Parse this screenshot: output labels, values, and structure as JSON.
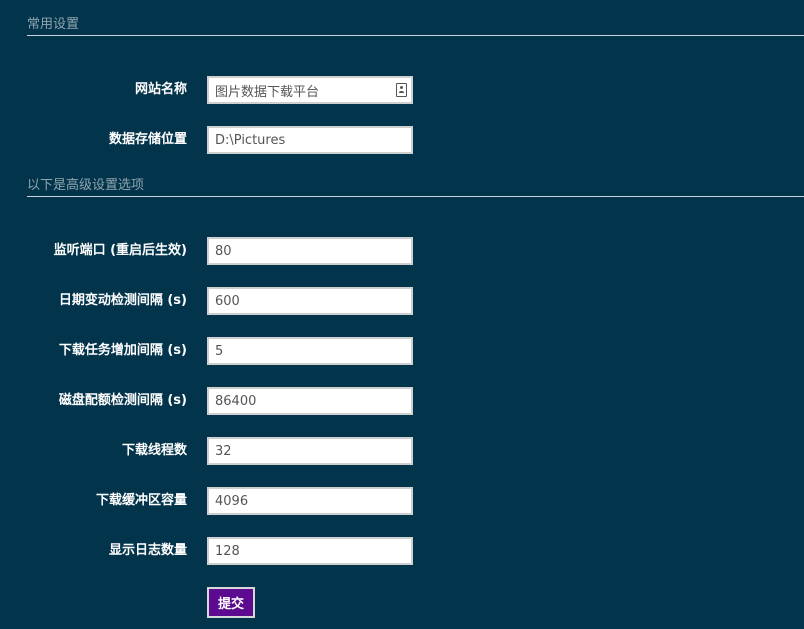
{
  "sections": {
    "common": {
      "title": "常用设置"
    },
    "advanced": {
      "title": "以下是高级设置选项"
    }
  },
  "fields": {
    "site_name": {
      "label": "网站名称",
      "value": "图片数据下载平台"
    },
    "storage_path": {
      "label": "数据存储位置",
      "value": "D:\\Pictures"
    },
    "listen_port": {
      "label": "监听端口 (重启后生效)",
      "value": "80"
    },
    "date_check_interval": {
      "label": "日期变动检测间隔 (s)",
      "value": "600"
    },
    "task_add_interval": {
      "label": "下载任务增加间隔 (s)",
      "value": "5"
    },
    "disk_quota_interval": {
      "label": "磁盘配额检测间隔 (s)",
      "value": "86400"
    },
    "download_threads": {
      "label": "下载线程数",
      "value": "32"
    },
    "buffer_size": {
      "label": "下载缓冲区容量",
      "value": "4096"
    },
    "log_count": {
      "label": "显示日志数量",
      "value": "128"
    }
  },
  "submit": {
    "label": "提交",
    "color": "#5c0a8f"
  },
  "icons": {
    "site_name_field_icon": "contact-card-icon"
  },
  "colors": {
    "background": "#02344b",
    "section_title": "#8fa5b0",
    "label": "#ffffff"
  }
}
